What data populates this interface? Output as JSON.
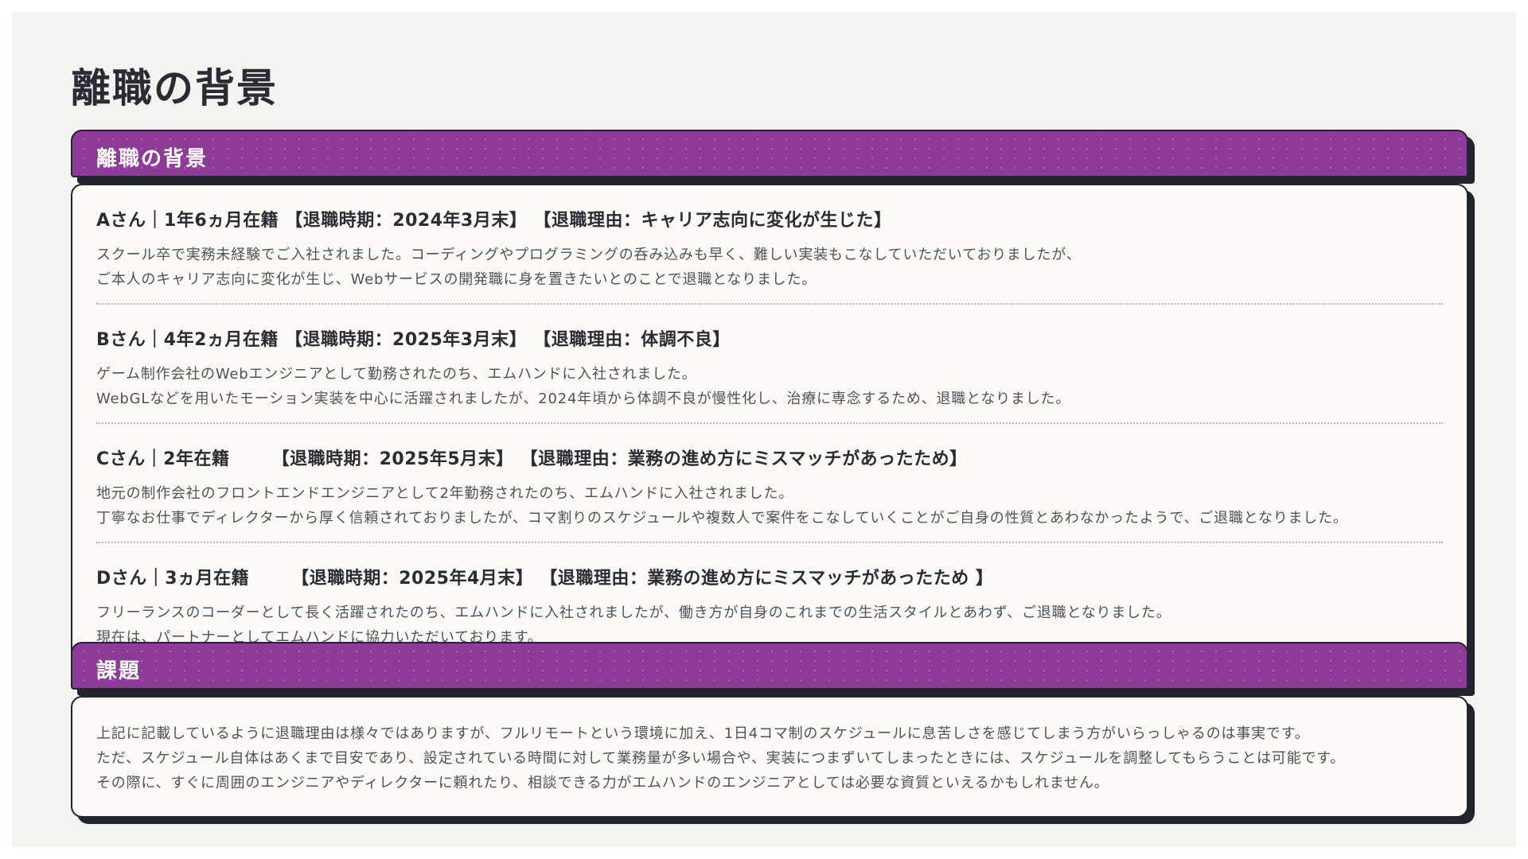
{
  "page_title": "離職の背景",
  "background_section": {
    "header": "離職の背景",
    "entries": [
      {
        "heading": "Aさん｜1年6ヵ月在籍 【退職時期：2024年3月末】 【退職理由：キャリア志向に変化が生じた】",
        "lines": [
          "スクール卒で実務未経験でご入社されました。コーディングやプログラミングの呑み込みも早く、難しい実装もこなしていただいておりましたが、",
          "ご本人のキャリア志向に変化が生じ、Webサービスの開発職に身を置きたいとのことで退職となりました。"
        ]
      },
      {
        "heading": "Bさん｜4年2ヵ月在籍 【退職時期：2025年3月末】 【退職理由：体調不良】",
        "lines": [
          "ゲーム制作会社のWebエンジニアとして勤務されたのち、エムハンドに入社されました。",
          "WebGLなどを用いたモーション実装を中心に活躍されましたが、2024年頃から体調不良が慢性化し、治療に専念するため、退職となりました。"
        ]
      },
      {
        "heading": "Cさん｜2年在籍　　 【退職時期：2025年5月末】 【退職理由：業務の進め方にミスマッチがあったため】",
        "lines": [
          "地元の制作会社のフロントエンドエンジニアとして2年勤務されたのち、エムハンドに入社されました。",
          "丁寧なお仕事でディレクターから厚く信頼されておりましたが、コマ割りのスケジュールや複数人で案件をこなしていくことがご自身の性質とあわなかったようで、ご退職となりました。"
        ]
      },
      {
        "heading": "Dさん｜3ヵ月在籍　　 【退職時期：2025年4月末】 【退職理由：業務の進め方にミスマッチがあったため 】",
        "lines": [
          "フリーランスのコーダーとして長く活躍されたのち、エムハンドに入社されましたが、働き方が自身のこれまでの生活スタイルとあわず、ご退職となりました。",
          "現在は、パートナーとしてエムハンドに協力いただいております。"
        ]
      }
    ]
  },
  "issue_section": {
    "header": "課題",
    "lines": [
      "上記に記載しているように退職理由は様々ではありますが、フルリモートという環境に加え、1日4コマ制のスケジュールに息苦しさを感じてしまう方がいらっしゃるのは事実です。",
      "ただ、スケジュール自体はあくまで目安であり、設定されている時間に対して業務量が多い場合や、実装につまずいてしまったときには、スケジュールを調整してもらうことは可能です。",
      "その際に、すぐに周囲のエンジニアやディレクターに頼れたり、相談できる力がエムハンドのエンジニアとしては必要な資質といえるかもしれません。"
    ]
  },
  "colors": {
    "accent": "#8e3a98",
    "border": "#22242e",
    "background": "#f3f3f2",
    "panel": "#fbfaf7"
  }
}
